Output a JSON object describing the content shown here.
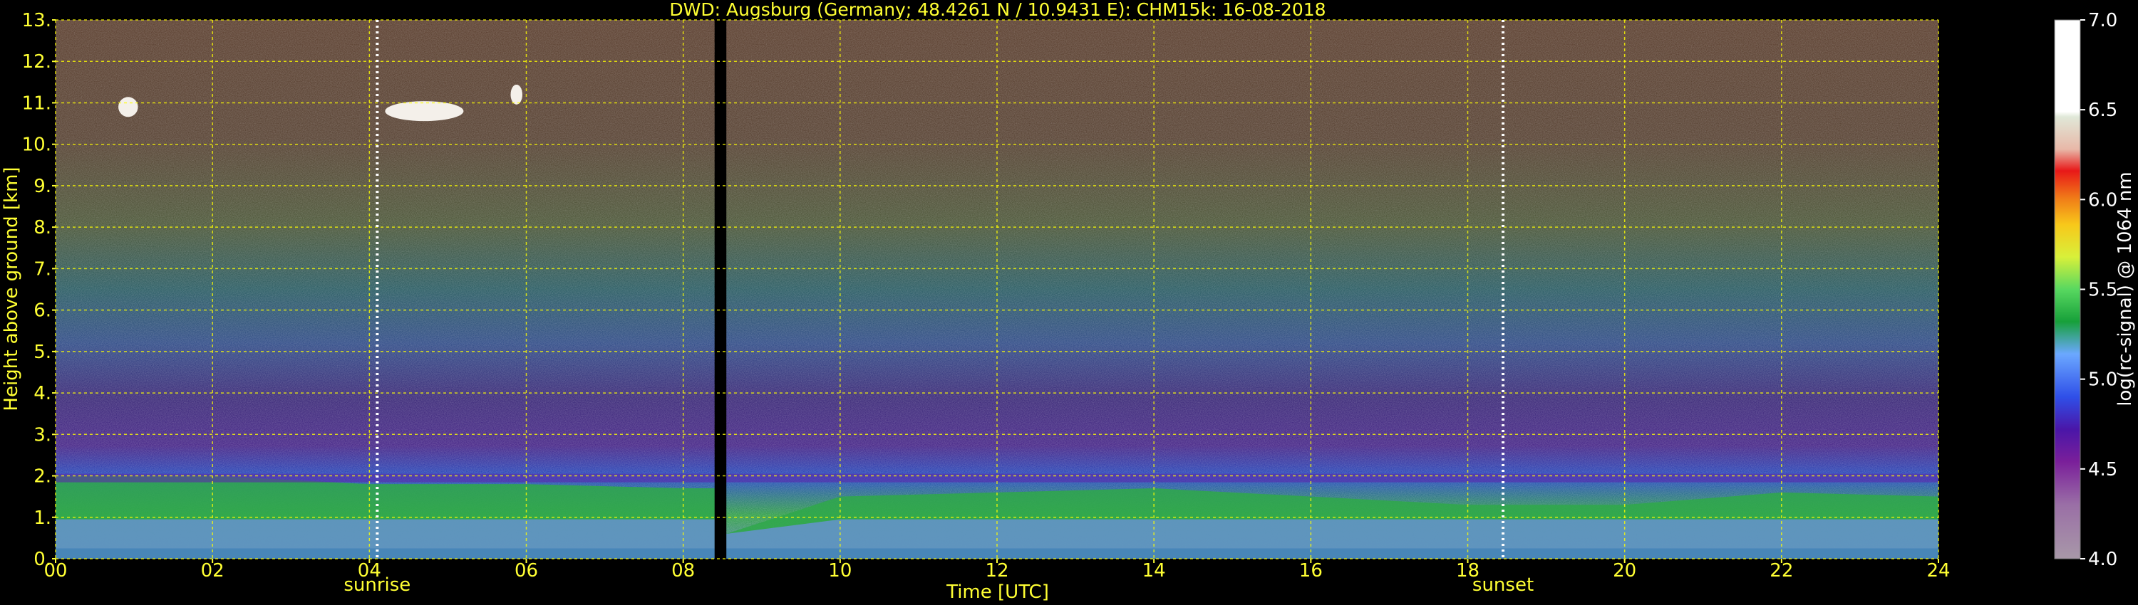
{
  "chart_data": {
    "type": "heatmap",
    "title": "DWD: Augsburg (Germany; 48.4261 N / 10.9431 E):    CHM15k: 16-08-2018",
    "xlabel": "Time [UTC]",
    "ylabel": "Height above ground [km]",
    "x_range": [
      0,
      24
    ],
    "y_range": [
      0,
      13
    ],
    "x_ticks": [
      "00",
      "02",
      "04",
      "06",
      "08",
      "10",
      "12",
      "14",
      "16",
      "18",
      "20",
      "22",
      "24"
    ],
    "y_ticks": [
      "0.",
      "1.",
      "2.",
      "3.",
      "4.",
      "5.",
      "6.",
      "7.",
      "8.",
      "9.",
      "10.",
      "11.",
      "12.",
      "13."
    ],
    "grid": true,
    "colorbar": {
      "label": "log(rc-signal) @ 1064 nm",
      "range": [
        4.0,
        7.0
      ],
      "ticks": [
        "4.0",
        "4.5",
        "5.0",
        "5.5",
        "6.0",
        "6.5",
        "7.0"
      ]
    },
    "annotations": [
      {
        "text": "sunrise",
        "x": 4.1
      },
      {
        "text": "sunset",
        "x": 18.45
      }
    ],
    "data_gap": [
      8.4,
      8.55
    ],
    "cloud_patches": [
      {
        "x_start": 0.8,
        "x_end": 1.05,
        "height_km": 10.9
      },
      {
        "x_start": 4.2,
        "x_end": 5.2,
        "height_km": 10.8
      },
      {
        "x_start": 5.8,
        "x_end": 5.95,
        "height_km": 11.2
      }
    ],
    "boundary_layer_top_km": [
      [
        0,
        2.0
      ],
      [
        2,
        2.0
      ],
      [
        4,
        1.8
      ],
      [
        6,
        1.8
      ],
      [
        8,
        1.7
      ],
      [
        8.4,
        1.7
      ],
      [
        8.55,
        0.6
      ],
      [
        10,
        1.5
      ],
      [
        12,
        1.6
      ],
      [
        14,
        1.7
      ],
      [
        16,
        1.5
      ],
      [
        18,
        1.3
      ],
      [
        20,
        1.3
      ],
      [
        22,
        1.6
      ],
      [
        24,
        1.5
      ]
    ],
    "colors": {
      "text": "#ffff33",
      "grid": "#ffff00",
      "sunrise_sunset_line": "#ffffff",
      "background": "#000000"
    }
  }
}
